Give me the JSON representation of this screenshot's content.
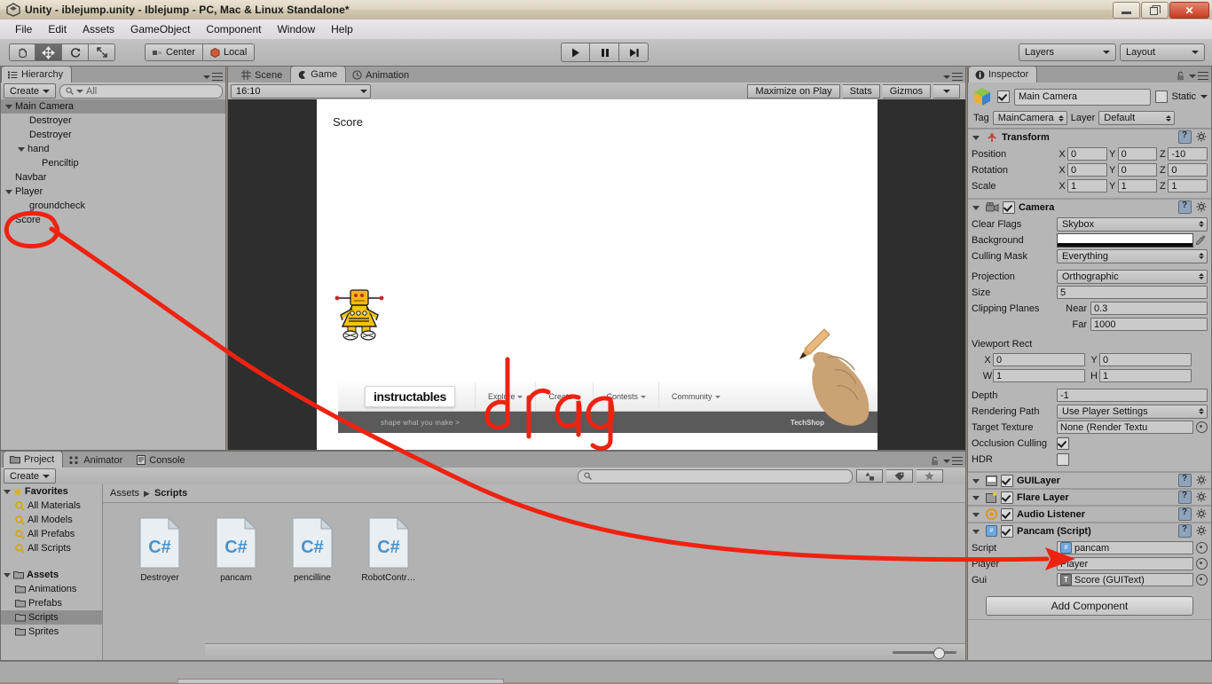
{
  "window": {
    "title": "Unity - iblejump.unity - Iblejump - PC, Mac & Linux Standalone*",
    "app_icon": "unity-icon",
    "minimize_label": "–",
    "restore_label": "❐",
    "close_label": "✕"
  },
  "menubar": {
    "items": [
      {
        "label": "File"
      },
      {
        "label": "Edit"
      },
      {
        "label": "Assets"
      },
      {
        "label": "GameObject"
      },
      {
        "label": "Component"
      },
      {
        "label": "Window"
      },
      {
        "label": "Help"
      }
    ]
  },
  "toolbar": {
    "tools": [
      {
        "name": "hand-tool",
        "icon": "hand-icon",
        "active": false
      },
      {
        "name": "move-tool",
        "icon": "move-icon",
        "active": true
      },
      {
        "name": "rotate-tool",
        "icon": "rotate-icon",
        "active": false
      },
      {
        "name": "scale-tool",
        "icon": "scale-icon",
        "active": false
      }
    ],
    "pivot_label": "Center",
    "space_label": "Local",
    "play_label": "play-icon",
    "pause_label": "pause-icon",
    "step_label": "step-icon",
    "layers_label": "Layers",
    "layout_label": "Layout"
  },
  "hierarchy": {
    "tab_label": "Hierarchy",
    "create_label": "Create",
    "search_placeholder": "All",
    "search_value": "",
    "items": [
      {
        "label": "Main Camera",
        "depth": 0,
        "expandable": true,
        "selected": true
      },
      {
        "label": "Destroyer",
        "depth": 1,
        "expandable": false,
        "selected": false
      },
      {
        "label": "Destroyer",
        "depth": 1,
        "expandable": false,
        "selected": false
      },
      {
        "label": "hand",
        "depth": 1,
        "expandable": true,
        "selected": false
      },
      {
        "label": "Penciltip",
        "depth": 2,
        "expandable": false,
        "selected": false
      },
      {
        "label": "Navbar",
        "depth": 0,
        "expandable": false,
        "selected": false
      },
      {
        "label": "Player",
        "depth": 0,
        "expandable": true,
        "selected": false
      },
      {
        "label": "groundcheck",
        "depth": 1,
        "expandable": false,
        "selected": false
      },
      {
        "label": "Score",
        "depth": 0,
        "expandable": false,
        "selected": false
      }
    ]
  },
  "center_dock": {
    "tabs": [
      {
        "label": "Scene",
        "icon": "grid-icon",
        "active": false
      },
      {
        "label": "Game",
        "icon": "gamepad-icon",
        "active": true
      },
      {
        "label": "Animation",
        "icon": "clock-icon",
        "active": false
      }
    ],
    "aspect_label": "16:10",
    "maximize_label": "Maximize on Play",
    "stats_label": "Stats",
    "gizmos_label": "Gizmos"
  },
  "game_view": {
    "score_text": "Score",
    "navbar": {
      "logo": "instructables",
      "links": [
        {
          "label": "Explore"
        },
        {
          "label": "Create"
        },
        {
          "label": "Contests"
        },
        {
          "label": "Community"
        }
      ],
      "tagline": "shape what you make  >",
      "right_label": "TechShop"
    },
    "annotation_text": "drag"
  },
  "inspector": {
    "tab_label": "Inspector",
    "object_name": "Main Camera",
    "enabled": true,
    "static_label": "Static",
    "static_checked": false,
    "tag_label": "Tag",
    "tag_value": "MainCamera",
    "layer_label": "Layer",
    "layer_value": "Default",
    "transform": {
      "title": "Transform",
      "enabled": true,
      "rows": [
        {
          "name": "Position",
          "x": "0",
          "y": "0",
          "z": "-10"
        },
        {
          "name": "Rotation",
          "x": "0",
          "y": "0",
          "z": "0"
        },
        {
          "name": "Scale",
          "x": "1",
          "y": "1",
          "z": "1"
        }
      ]
    },
    "camera": {
      "title": "Camera",
      "enabled": true,
      "clear_flags_label": "Clear Flags",
      "clear_flags_value": "Skybox",
      "background_label": "Background",
      "background_color": "#ffffff",
      "culling_mask_label": "Culling Mask",
      "culling_mask_value": "Everything",
      "projection_label": "Projection",
      "projection_value": "Orthographic",
      "size_label": "Size",
      "size_value": "5",
      "clipping_label": "Clipping Planes",
      "near_label": "Near",
      "near_value": "0.3",
      "far_label": "Far",
      "far_value": "1000",
      "viewport_label": "Viewport Rect",
      "viewport_x_label": "X",
      "viewport_x": "0",
      "viewport_y_label": "Y",
      "viewport_y": "0",
      "viewport_w_label": "W",
      "viewport_w": "1",
      "viewport_h_label": "H",
      "viewport_h": "1",
      "depth_label": "Depth",
      "depth_value": "-1",
      "rendering_path_label": "Rendering Path",
      "rendering_path_value": "Use Player Settings",
      "target_texture_label": "Target Texture",
      "target_texture_value": "None (Render Textu",
      "occlusion_label": "Occlusion Culling",
      "occlusion_checked": true,
      "hdr_label": "HDR",
      "hdr_checked": false
    },
    "components": [
      {
        "title": "GUILayer",
        "enabled": true,
        "icon": "guilayer-icon"
      },
      {
        "title": "Flare Layer",
        "enabled": true,
        "icon": "flare-icon"
      },
      {
        "title": "Audio Listener",
        "enabled": true,
        "icon": "audio-icon"
      }
    ],
    "script_component": {
      "title": "Pancam (Script)",
      "enabled": true,
      "rows": [
        {
          "name": "Script",
          "value": "pancam",
          "icon": "cs-icon"
        },
        {
          "name": "Player",
          "value": "Player",
          "icon": ""
        },
        {
          "name": "Gui",
          "value": "Score (GUIText)",
          "icon": "text-icon"
        }
      ]
    },
    "add_component_label": "Add Component"
  },
  "project": {
    "tabs": [
      {
        "label": "Project",
        "icon": "folder-icon",
        "active": true
      },
      {
        "label": "Animator",
        "icon": "animator-icon",
        "active": false
      },
      {
        "label": "Console",
        "icon": "console-icon",
        "active": false
      }
    ],
    "create_label": "Create",
    "search_value": "",
    "tree": [
      {
        "label": "Favorites",
        "type": "star",
        "depth": 0,
        "bold": true,
        "selected": false
      },
      {
        "label": "All Materials",
        "type": "search",
        "depth": 1,
        "bold": false,
        "selected": false
      },
      {
        "label": "All Models",
        "type": "search",
        "depth": 1,
        "bold": false,
        "selected": false
      },
      {
        "label": "All Prefabs",
        "type": "search",
        "depth": 1,
        "bold": false,
        "selected": false
      },
      {
        "label": "All Scripts",
        "type": "search",
        "depth": 1,
        "bold": false,
        "selected": false
      },
      {
        "label": "",
        "type": "gap",
        "depth": 0,
        "bold": false,
        "selected": false
      },
      {
        "label": "Assets",
        "type": "folder",
        "depth": 0,
        "bold": true,
        "selected": false
      },
      {
        "label": "Animations",
        "type": "folder",
        "depth": 1,
        "bold": false,
        "selected": false
      },
      {
        "label": "Prefabs",
        "type": "folder",
        "depth": 1,
        "bold": false,
        "selected": false
      },
      {
        "label": "Scripts",
        "type": "folder",
        "depth": 1,
        "bold": false,
        "selected": true
      },
      {
        "label": "Sprites",
        "type": "folder",
        "depth": 1,
        "bold": false,
        "selected": false
      }
    ],
    "breadcrumb": [
      {
        "label": "Assets",
        "current": false
      },
      {
        "label": "Scripts",
        "current": true
      }
    ],
    "assets": [
      {
        "name": "Destroyer",
        "type": "cs"
      },
      {
        "name": "pancam",
        "type": "cs"
      },
      {
        "name": "pencilline",
        "type": "cs"
      },
      {
        "name": "RobotContr…",
        "type": "cs"
      }
    ],
    "zoom_value": "64"
  },
  "colors": {
    "annotation": "#ee2211",
    "panel_bg": "#b6b6b6",
    "selection": "#8f8f8f",
    "toolbar": "#bdbdbd"
  }
}
